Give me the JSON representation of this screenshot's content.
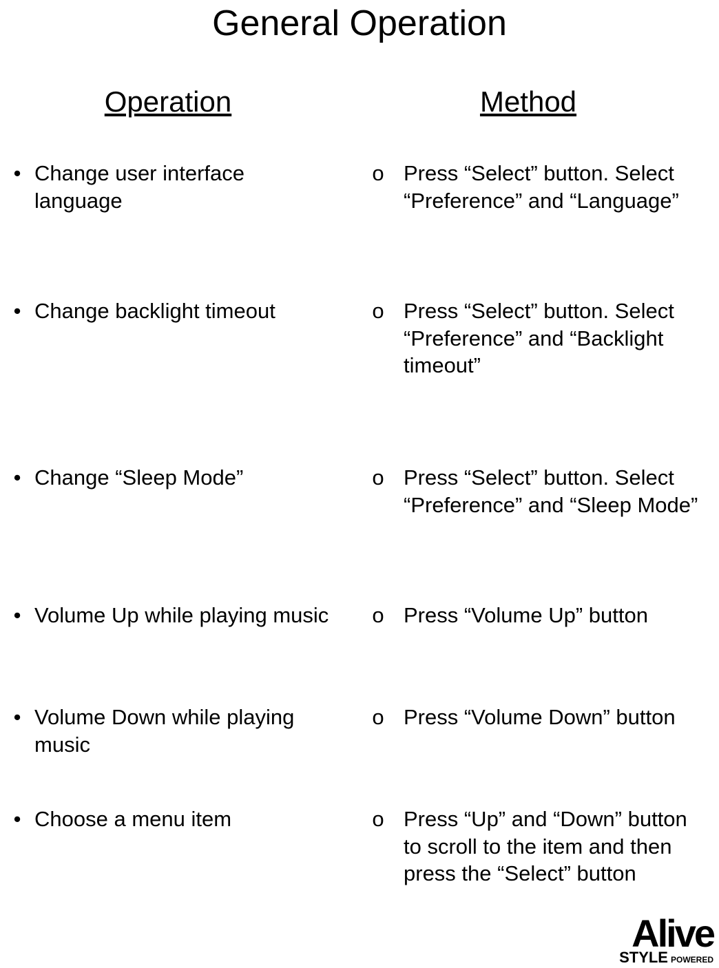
{
  "title": "General Operation",
  "columns": {
    "operation": {
      "header": "Operation",
      "bullet": "•",
      "items": [
        "Change user interface language",
        "Change backlight timeout",
        "Change “Sleep Mode”",
        "Volume Up while playing music",
        "Volume Down while playing music",
        "Choose a menu item"
      ]
    },
    "method": {
      "header": "Method",
      "bullet": "o",
      "items": [
        "Press “Select” button. Select “Preference” and “Language”",
        "Press “Select” button. Select “Preference” and “Backlight timeout”",
        "Press “Select” button. Select “Preference” and “Sleep Mode”",
        "Press “Volume Up” button",
        "Press “Volume Down” button",
        "Press “Up” and “Down” button to scroll to the item and then press the “Select” button"
      ]
    }
  },
  "logo": {
    "brand": "Alive",
    "line2a": "STYLE",
    "line2b": "POWERED"
  }
}
